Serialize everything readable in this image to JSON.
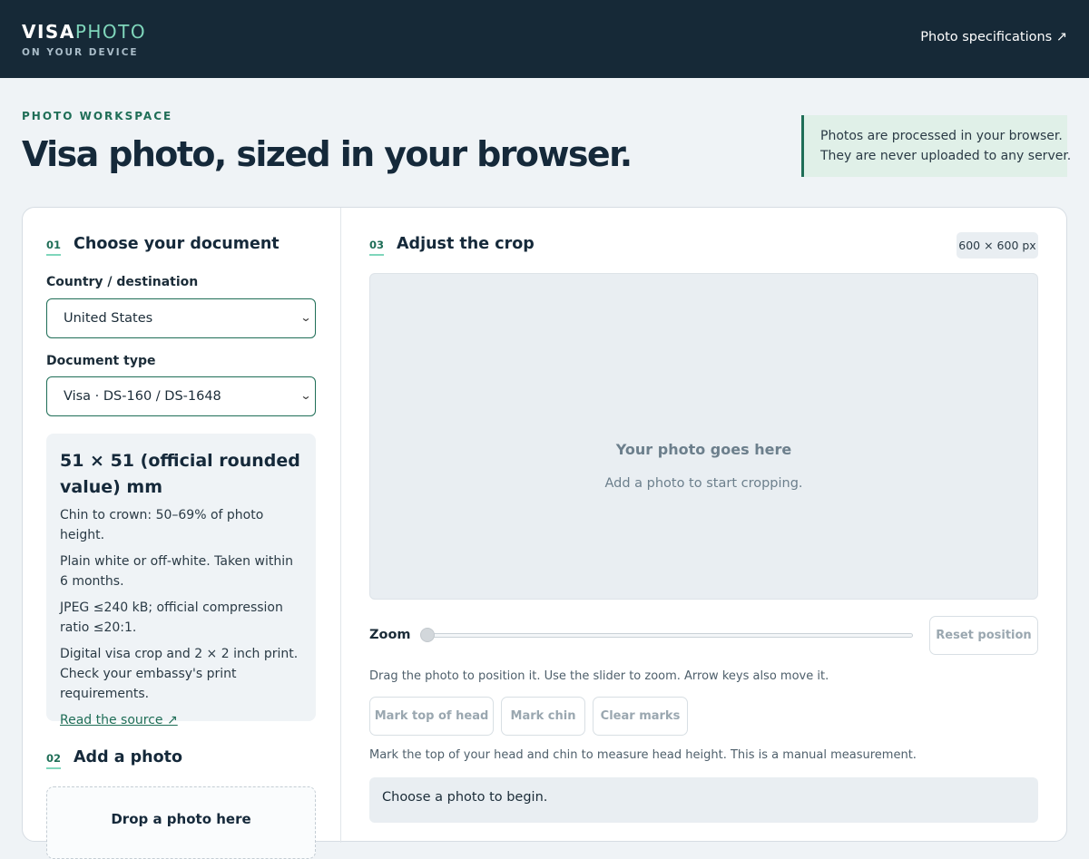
{
  "header": {
    "brand_primary": "VISA",
    "brand_secondary": "PHOTO",
    "brand_tagline": "ON YOUR DEVICE",
    "spec_link": "Photo specifications ↗"
  },
  "hero": {
    "eyebrow": "PHOTO WORKSPACE",
    "title": "Visa photo, sized in your browser.",
    "privacy_line1": "Photos are processed in your browser.",
    "privacy_line2": "They are never uploaded to any server."
  },
  "left": {
    "step1": {
      "num": "01",
      "title": "Choose your document"
    },
    "country_label": "Country / destination",
    "country_value": "United States",
    "doctype_label": "Document type",
    "doctype_value": "Visa · DS-160 / DS-1648",
    "spec": {
      "size": "51 × 51 (official rounded value) mm",
      "chin": "Chin to crown: 50–69% of photo height.",
      "background": "Plain white or off-white. Taken within 6 months.",
      "file": "JPEG ≤240 kB; official compression ratio ≤20:1.",
      "print": "Digital visa crop and 2 × 2 inch print. Check your embassy's print requirements.",
      "source_link": "Read the source ↗"
    },
    "step2": {
      "num": "02",
      "title": "Add a photo"
    },
    "dropzone_text": "Drop a photo here"
  },
  "right": {
    "step3": {
      "num": "03",
      "title": "Adjust the crop"
    },
    "dimension_badge": "600 × 600 px",
    "placeholder_title": "Your photo goes here",
    "placeholder_sub": "Add a photo to start cropping.",
    "zoom_label": "Zoom",
    "zoom_level": 0,
    "reset_button": "Reset position",
    "drag_hint": "Drag the photo to position it. Use the slider to zoom. Arrow keys also move it.",
    "mark_top_button": "Mark top of head",
    "mark_chin_button": "Mark chin",
    "clear_marks_button": "Clear marks",
    "measure_hint": "Mark the top of your head and chin to measure head height. This is a manual measurement.",
    "status": "Choose a photo to begin."
  },
  "colors": {
    "header_bg": "#162937",
    "accent": "#1f6e57",
    "accent_light": "#7fd6bb",
    "privacy_bg": "#e0f0e8"
  }
}
